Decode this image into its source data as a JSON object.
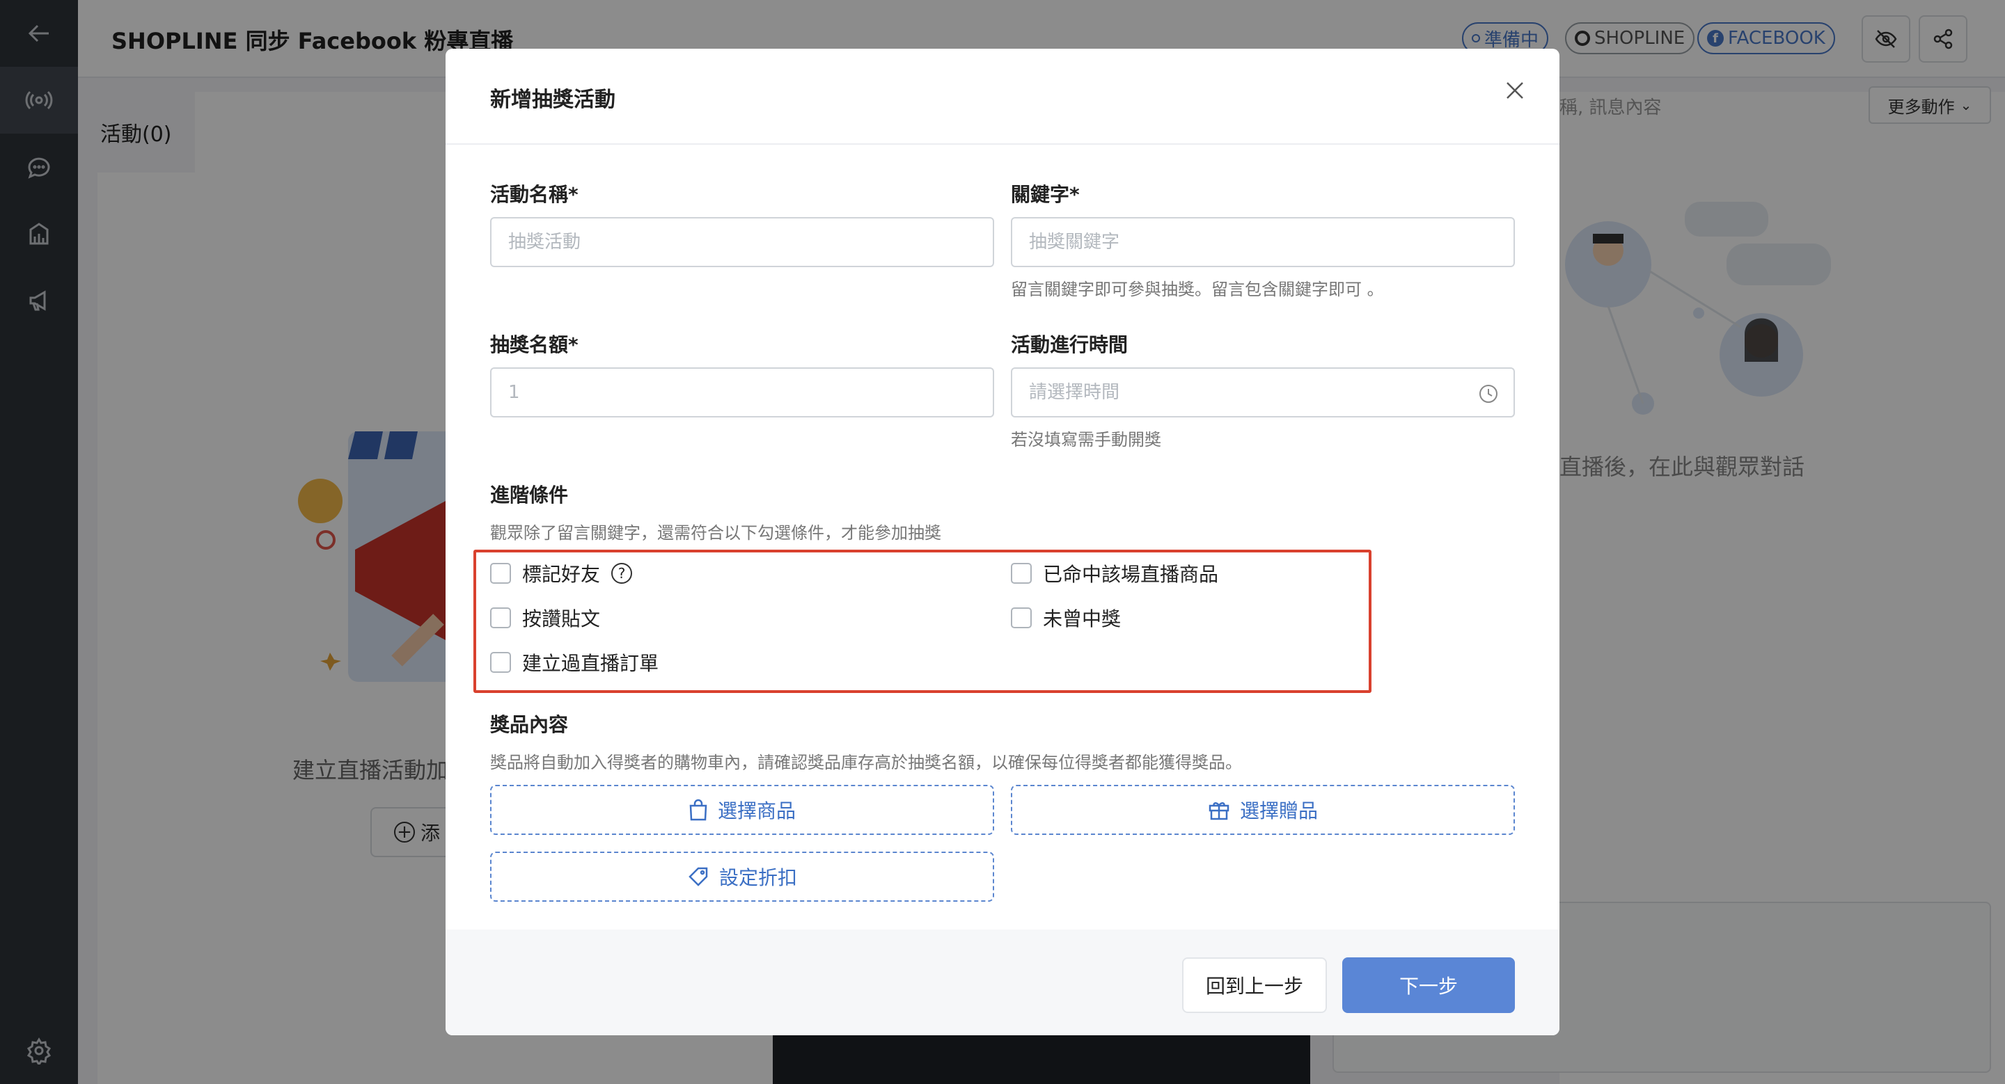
{
  "header": {
    "title": "SHOPLINE 同步 Facebook 粉專直播",
    "status_badge": "準備中",
    "shopline_badge": "SHOPLINE",
    "facebook_badge": "FACEBOOK"
  },
  "left_panel": {
    "tab_label": "活動(0)",
    "empty_text": "建立直播活動加",
    "add_label": "添"
  },
  "right_panel": {
    "search_placeholder": "稱, 訊息內容",
    "more_actions": "更多動作",
    "empty_text": "直播後，在此與觀眾對話"
  },
  "modal": {
    "title": "新增抽獎活動",
    "activity_name": {
      "label": "活動名稱*",
      "placeholder": "抽獎活動"
    },
    "keyword": {
      "label": "關鍵字*",
      "placeholder": "抽獎關鍵字",
      "help": "留言關鍵字即可參與抽獎。留言包含關鍵字即可 。"
    },
    "winners": {
      "label": "抽獎名額*",
      "placeholder": "1"
    },
    "duration": {
      "label": "活動進行時間",
      "placeholder": "請選擇時間",
      "help": "若沒填寫需手動開獎"
    },
    "advanced": {
      "label": "進階條件",
      "help": "觀眾除了留言關鍵字，還需符合以下勾選條件，才能參加抽獎",
      "options": {
        "tag_friend": "標記好友",
        "like_post": "按讚貼文",
        "placed_order": "建立過直播訂單",
        "won_product": "已命中該場直播商品",
        "never_won": "未曾中獎"
      }
    },
    "prize": {
      "label": "獎品內容",
      "help": "獎品將自動加入得獎者的購物車內，請確認獎品庫存高於抽獎名額，以確保每位得獎者都能獲得獎品。",
      "select_product": "選擇商品",
      "select_gift": "選擇贈品",
      "set_discount": "設定折扣"
    },
    "back_button": "回到上一步",
    "next_button": "下一步"
  },
  "colors": {
    "sidebar": "#2e3339",
    "primary": "#5a86d6",
    "highlight": "#d9412e"
  }
}
